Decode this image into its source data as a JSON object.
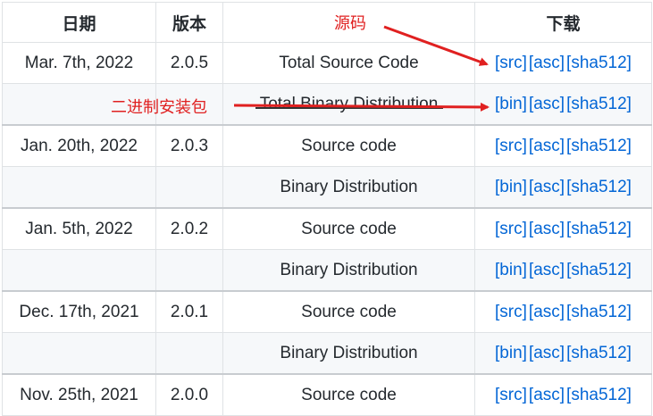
{
  "headers": {
    "date": "日期",
    "version": "版本",
    "desc": "",
    "download": "下载"
  },
  "annotations": {
    "source": "源码",
    "binary": "二进制安装包"
  },
  "rows": [
    {
      "date": "Mar. 7th, 2022",
      "version": "2.0.5",
      "desc": "Total Source Code",
      "links": [
        "[src]",
        "[asc]",
        "[sha512]"
      ]
    },
    {
      "date": "",
      "version": "",
      "desc": "Total Binary Distribution",
      "links": [
        "[bin]",
        "[asc]",
        "[sha512]"
      ]
    },
    {
      "date": "Jan. 20th, 2022",
      "version": "2.0.3",
      "desc": "Source code",
      "links": [
        "[src]",
        "[asc]",
        "[sha512]"
      ]
    },
    {
      "date": "",
      "version": "",
      "desc": "Binary Distribution",
      "links": [
        "[bin]",
        "[asc]",
        "[sha512]"
      ]
    },
    {
      "date": "Jan. 5th, 2022",
      "version": "2.0.2",
      "desc": "Source code",
      "links": [
        "[src]",
        "[asc]",
        "[sha512]"
      ]
    },
    {
      "date": "",
      "version": "",
      "desc": "Binary Distribution",
      "links": [
        "[bin]",
        "[asc]",
        "[sha512]"
      ]
    },
    {
      "date": "Dec. 17th, 2021",
      "version": "2.0.1",
      "desc": "Source code",
      "links": [
        "[src]",
        "[asc]",
        "[sha512]"
      ]
    },
    {
      "date": "",
      "version": "",
      "desc": "Binary Distribution",
      "links": [
        "[bin]",
        "[asc]",
        "[sha512]"
      ]
    },
    {
      "date": "Nov. 25th, 2021",
      "version": "2.0.0",
      "desc": "Source code",
      "links": [
        "[src]",
        "[asc]",
        "[sha512]"
      ]
    }
  ],
  "colors": {
    "link": "#0366d6",
    "annotation": "#e02020",
    "alt_row": "#f6f8fa",
    "border": "#dfe2e5"
  }
}
